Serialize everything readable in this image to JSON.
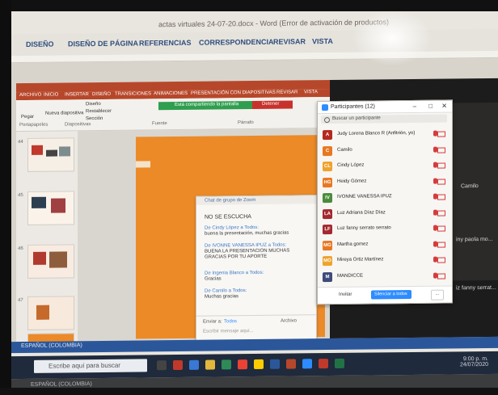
{
  "word": {
    "title": "actas virtuales 24-07-20.docx - Word (Error de activación de productos)",
    "ribbon": [
      "DISEÑO",
      "DISEÑO DE PÁGINA",
      "REFERENCIAS",
      "CORRESPONDENCIA",
      "REVISAR",
      "VISTA"
    ],
    "status_language": "ESPAÑOL (COLOMBIA)"
  },
  "powerpoint": {
    "tabs": [
      "ARCHIVO",
      "INICIO",
      "INSERTAR",
      "DISEÑO",
      "TRANSICIONES",
      "ANIMACIONES",
      "PRESENTACIÓN CON DIAPOSITIVAS",
      "REVISAR",
      "VISTA"
    ],
    "groups": [
      "Portapapeles",
      "Diapositivas",
      "Fuente",
      "Párrafo"
    ],
    "toolbar_labels": [
      "Pegar",
      "Nueva diapositiva",
      "Diseño",
      "Restablecer",
      "Sección"
    ],
    "share_bar": "Está compartiendo la pantalla",
    "stop_share": "Detener",
    "slide_numbers": [
      "44",
      "45",
      "46",
      "47"
    ]
  },
  "zoom_chat": {
    "title": "Chat de grupo de Zoom",
    "top_message": "NO SE ESCUCHA",
    "messages": [
      {
        "from": "De Cindy López a Todos:",
        "text": "buena la presentación, muchas gracias"
      },
      {
        "from": "De IVONNE VANESSA IPUZ a Todos:",
        "text": "BUENA LA PRESENTACION MUCHAS GRACIAS POR TU APORTE"
      },
      {
        "from": "De Ingenia Blanco a Todos:",
        "text": "Gracias"
      },
      {
        "from": "De Camilo a Todos:",
        "text": "Muchas gracias"
      }
    ],
    "to_label": "Enviar a:",
    "to_value": "Todos",
    "file_label": "Archivo",
    "input_placeholder": "Escribir mensaje aquí..."
  },
  "participants": {
    "title": "Participantes (12)",
    "search_placeholder": "Buscar un participante",
    "list": [
      {
        "initial": "A",
        "name": "Judy Lorena Blanco R (Anfitrión, yo)",
        "color": "#b5281f"
      },
      {
        "initial": "C",
        "name": "Camilo",
        "color": "#e87722"
      },
      {
        "initial": "CL",
        "name": "Cindy López",
        "color": "#f0a22c"
      },
      {
        "initial": "HG",
        "name": "Heidy Gómez",
        "color": "#e87722"
      },
      {
        "initial": "IV",
        "name": "IVONNE VANESSA IPUZ",
        "color": "#4a8b3c"
      },
      {
        "initial": "LA",
        "name": "Luz Adriana Díaz Díaz",
        "color": "#a3282f"
      },
      {
        "initial": "LF",
        "name": "Luz fanny serrato serrato",
        "color": "#a3282f"
      },
      {
        "initial": "MG",
        "name": "Martha gomez",
        "color": "#e87722"
      },
      {
        "initial": "MO",
        "name": "Mireya Ortiz Martínez",
        "color": "#f0a22c"
      },
      {
        "initial": "M",
        "name": "MANDICCE",
        "color": "#3d4a7a"
      }
    ],
    "invite": "Invitar",
    "mute_all": "Silenciar a todos",
    "more": "..."
  },
  "zoom_side": {
    "video_name": "Camilo",
    "name_2": "iny paola mo...",
    "name_3": "iz fanny serrat..."
  },
  "taskbar": {
    "search_placeholder": "Escribe aquí para buscar",
    "clock_time": "9:00 p. m.",
    "clock_date": "24/07/2020"
  }
}
